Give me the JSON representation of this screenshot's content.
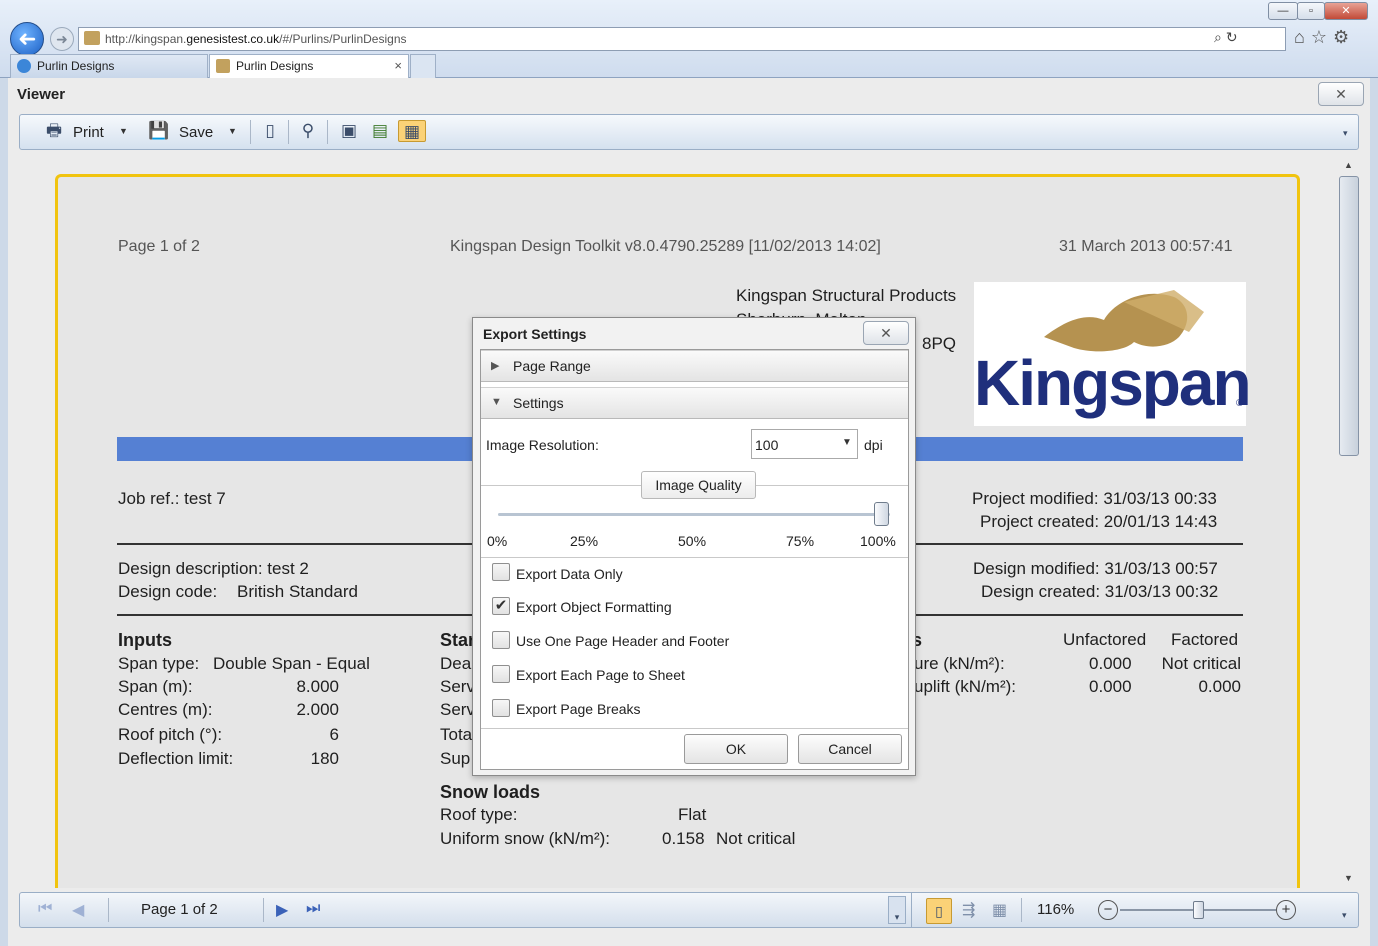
{
  "browser": {
    "url_prefix": "http://kingspan.",
    "url_domain": "genesistest.co.uk",
    "url_path": "/#/Purlins/PurlinDesigns",
    "tabs": [
      {
        "label": "Purlin Designs"
      },
      {
        "label": "Purlin Designs"
      }
    ],
    "tab_close": "×",
    "back_glyph": "➜",
    "forward_glyph": "➜"
  },
  "viewer": {
    "title": "Viewer",
    "close_glyph": "✕",
    "toolbar": {
      "print_label": "Print",
      "save_label": "Save"
    }
  },
  "report": {
    "page_label": "Page 1 of 2",
    "app_version": "Kingspan Design Toolkit v8.0.4790.25289 [11/02/2013 14:02]",
    "printed_at": "31 March 2013 00:57:41",
    "company_line1": "Kingspan Structural Products",
    "company_line2": "Sherburn, Malton",
    "company_postcode_tail": "8PQ",
    "logo_text": "Kingspan",
    "logo_mark": "®",
    "job_ref": "Job ref.: test 7",
    "project_modified": "Project modified: 31/03/13 00:33",
    "project_created": "Project created: 20/01/13 14:43",
    "design_description": "Design description: test 2",
    "design_code_label": "Design code:",
    "design_code_value": "British Standard",
    "design_modified": "Design modified: 31/03/13 00:57",
    "design_created": "Design created: 31/03/13 00:32",
    "inputs": {
      "heading": "Inputs",
      "span_type_label": "Span type:",
      "span_type_value": "Double Span - Equal",
      "rows": [
        {
          "label": "Span (m):",
          "value": "8.000"
        },
        {
          "label": "Centres (m):",
          "value": "2.000"
        },
        {
          "label": "Roof pitch (°):",
          "value": "6"
        },
        {
          "label": "Deflection limit:",
          "value": "180"
        }
      ]
    },
    "middle_col": {
      "heading_frag": "Star",
      "frags": [
        "Dea",
        "Serv",
        "Serv",
        "Tota",
        "Sup"
      ]
    },
    "snow": {
      "heading": "Snow loads",
      "roof_type_label": "Roof type:",
      "roof_type_value": "Flat",
      "uniform_label": "Uniform snow (kN/m²):",
      "uniform_value": "0.158",
      "uniform_status": "Not critical"
    },
    "wind": {
      "heading_frag": "s",
      "col_unfactored": "Unfactored",
      "col_factored": "Factored",
      "rows": [
        {
          "label_frag": "ure (kN/m²):",
          "unfactored": "0.000",
          "factored": "Not critical"
        },
        {
          "label_frag": "uplift (kN/m²):",
          "unfactored": "0.000",
          "factored": "0.000"
        }
      ]
    }
  },
  "statusbar": {
    "page_label": "Page 1 of 2",
    "zoom": "116%",
    "zoom_minus": "−",
    "zoom_plus": "+"
  },
  "dialog": {
    "title": "Export Settings",
    "close_glyph": "✕",
    "section_page_range": "Page Range",
    "section_settings": "Settings",
    "resolution_label": "Image Resolution:",
    "resolution_value": "100",
    "resolution_unit": "dpi",
    "quality_label": "Image Quality",
    "quality_fraction": 1.0,
    "ticks": [
      "0%",
      "25%",
      "50%",
      "75%",
      "100%"
    ],
    "options": [
      {
        "label": "Export Data Only",
        "checked": false
      },
      {
        "label": "Export Object Formatting",
        "checked": true
      },
      {
        "label": "Use One Page Header and Footer",
        "checked": false
      },
      {
        "label": "Export Each Page to Sheet",
        "checked": false
      },
      {
        "label": "Export Page Breaks",
        "checked": false
      }
    ],
    "ok_label": "OK",
    "cancel_label": "Cancel",
    "check_glyph": "✔"
  },
  "icons": [
    "back-icon",
    "forward-icon",
    "search-icon",
    "refresh-icon",
    "home-icon",
    "star-icon",
    "gear-icon",
    "print-icon",
    "save-icon",
    "binoculars-icon",
    "first-page-icon",
    "last-page-icon"
  ],
  "colors": {
    "accent_yellow": "#f1c40f",
    "band_blue": "#5580d3",
    "logo_navy": "#1f2f7c"
  }
}
